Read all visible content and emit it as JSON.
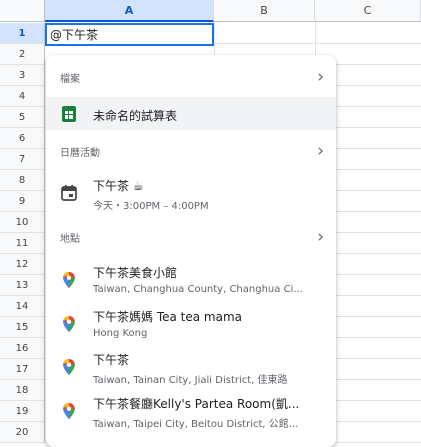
{
  "columns": [
    "A",
    "B",
    "C"
  ],
  "rows": [
    "1",
    "2",
    "3",
    "4",
    "5",
    "6",
    "7",
    "8",
    "9",
    "10",
    "11",
    "12",
    "13",
    "14",
    "15",
    "16",
    "17",
    "18",
    "19",
    "20"
  ],
  "active_cell_value": "@下午茶",
  "popup": {
    "files": {
      "header": "檔案",
      "items": [
        {
          "title": "未命名的試算表",
          "icon": "sheets-icon",
          "color": "#188038"
        }
      ]
    },
    "calendar": {
      "header": "日曆活動",
      "items": [
        {
          "title": "下午茶 ☕",
          "subtitle": "今天・3:00PM – 4:00PM",
          "icon": "calendar-event-icon"
        }
      ]
    },
    "places": {
      "header": "地點",
      "items": [
        {
          "title": "下午茶美食小館",
          "subtitle": "Taiwan, Changhua County, Changhua Ci...",
          "icon": "map-pin-icon"
        },
        {
          "title": "下午茶媽媽 Tea tea mama",
          "subtitle": "Hong Kong",
          "icon": "map-pin-icon"
        },
        {
          "title": "下午茶",
          "subtitle": "Taiwan, Tainan City, Jiali District, 佳東路",
          "icon": "map-pin-icon"
        },
        {
          "title": "下午茶餐廳Kelly's Partea Room(凱...",
          "subtitle": "Taiwan, Taipei City, Beitou District, 公館...",
          "icon": "map-pin-icon"
        }
      ]
    }
  },
  "colors": {
    "accent": "#1a73e8",
    "header_bg": "#f8f9fa",
    "selected_header": "#d3e3fd"
  }
}
